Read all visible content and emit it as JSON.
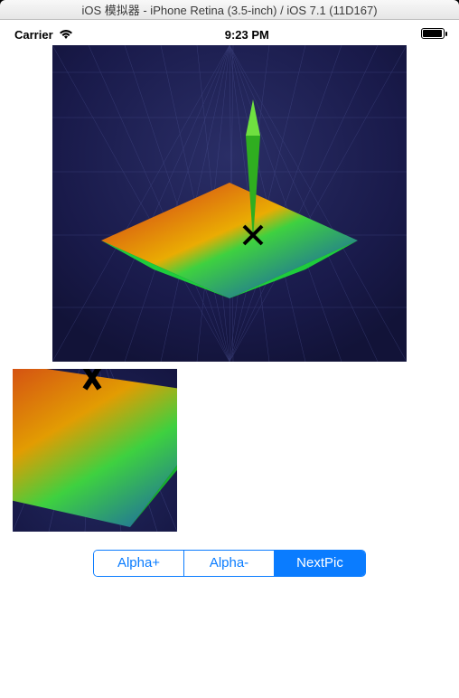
{
  "window": {
    "title": "iOS 模拟器 - iPhone Retina (3.5-inch) / iOS 7.1 (11D167)"
  },
  "status_bar": {
    "carrier": "Carrier",
    "time": "9:23 PM"
  },
  "segmented": {
    "alpha_plus": "Alpha+",
    "alpha_minus": "Alpha-",
    "next_pic": "NextPic"
  }
}
